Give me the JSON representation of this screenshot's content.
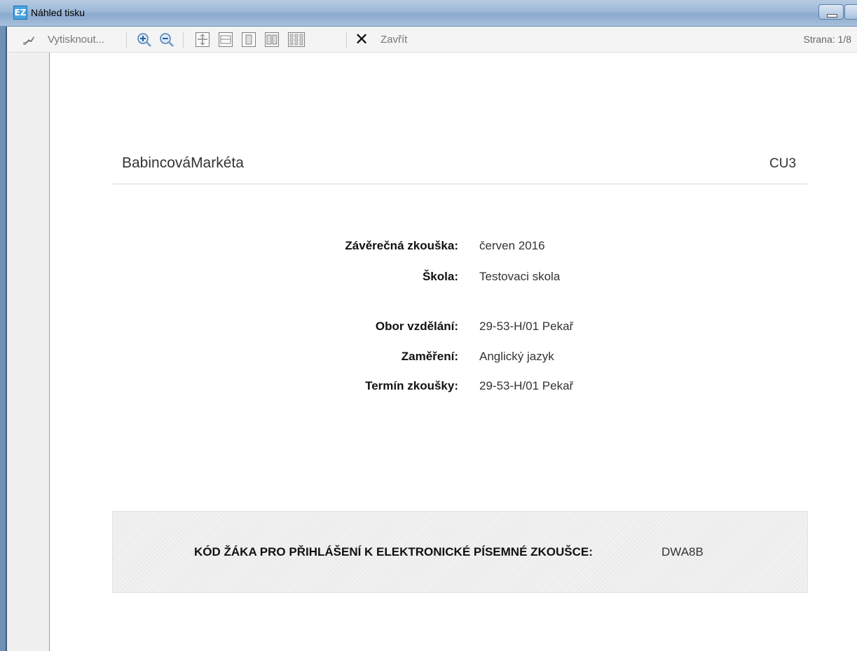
{
  "window": {
    "title": "Náhled tisku",
    "app_icon": "EZ"
  },
  "toolbar": {
    "print_label": "Vytisknout...",
    "close_label": "Zavřít",
    "page_indicator": "Strana: 1/8",
    "icons": [
      "print-icon",
      "zoom-in-icon",
      "zoom-out-icon",
      "fit-page-icon",
      "page-width-icon",
      "single-page-icon",
      "two-pages-icon",
      "multi-page-icon",
      "close-icon"
    ]
  },
  "document": {
    "student_name": "BabincováMarkéta",
    "class_code": "CU3",
    "fields": [
      {
        "label": "Závěrečná zkouška:",
        "value": "červen 2016"
      },
      {
        "label": "Škola:",
        "value": "Testovaci skola"
      },
      {
        "label": "Obor vzdělání:",
        "value": "29-53-H/01 Pekař"
      },
      {
        "label": "Zaměření:",
        "value": "Anglický jazyk"
      },
      {
        "label": "Termín zkoušky:",
        "value": "29-53-H/01 Pekař"
      }
    ],
    "login_code_label": "KÓD ŽÁKA PRO PŘIHLÁŠENÍ K ELEKTRONICKÉ PÍSEMNÉ ZKOUŠCE:",
    "login_code_value": "DWA8B"
  }
}
